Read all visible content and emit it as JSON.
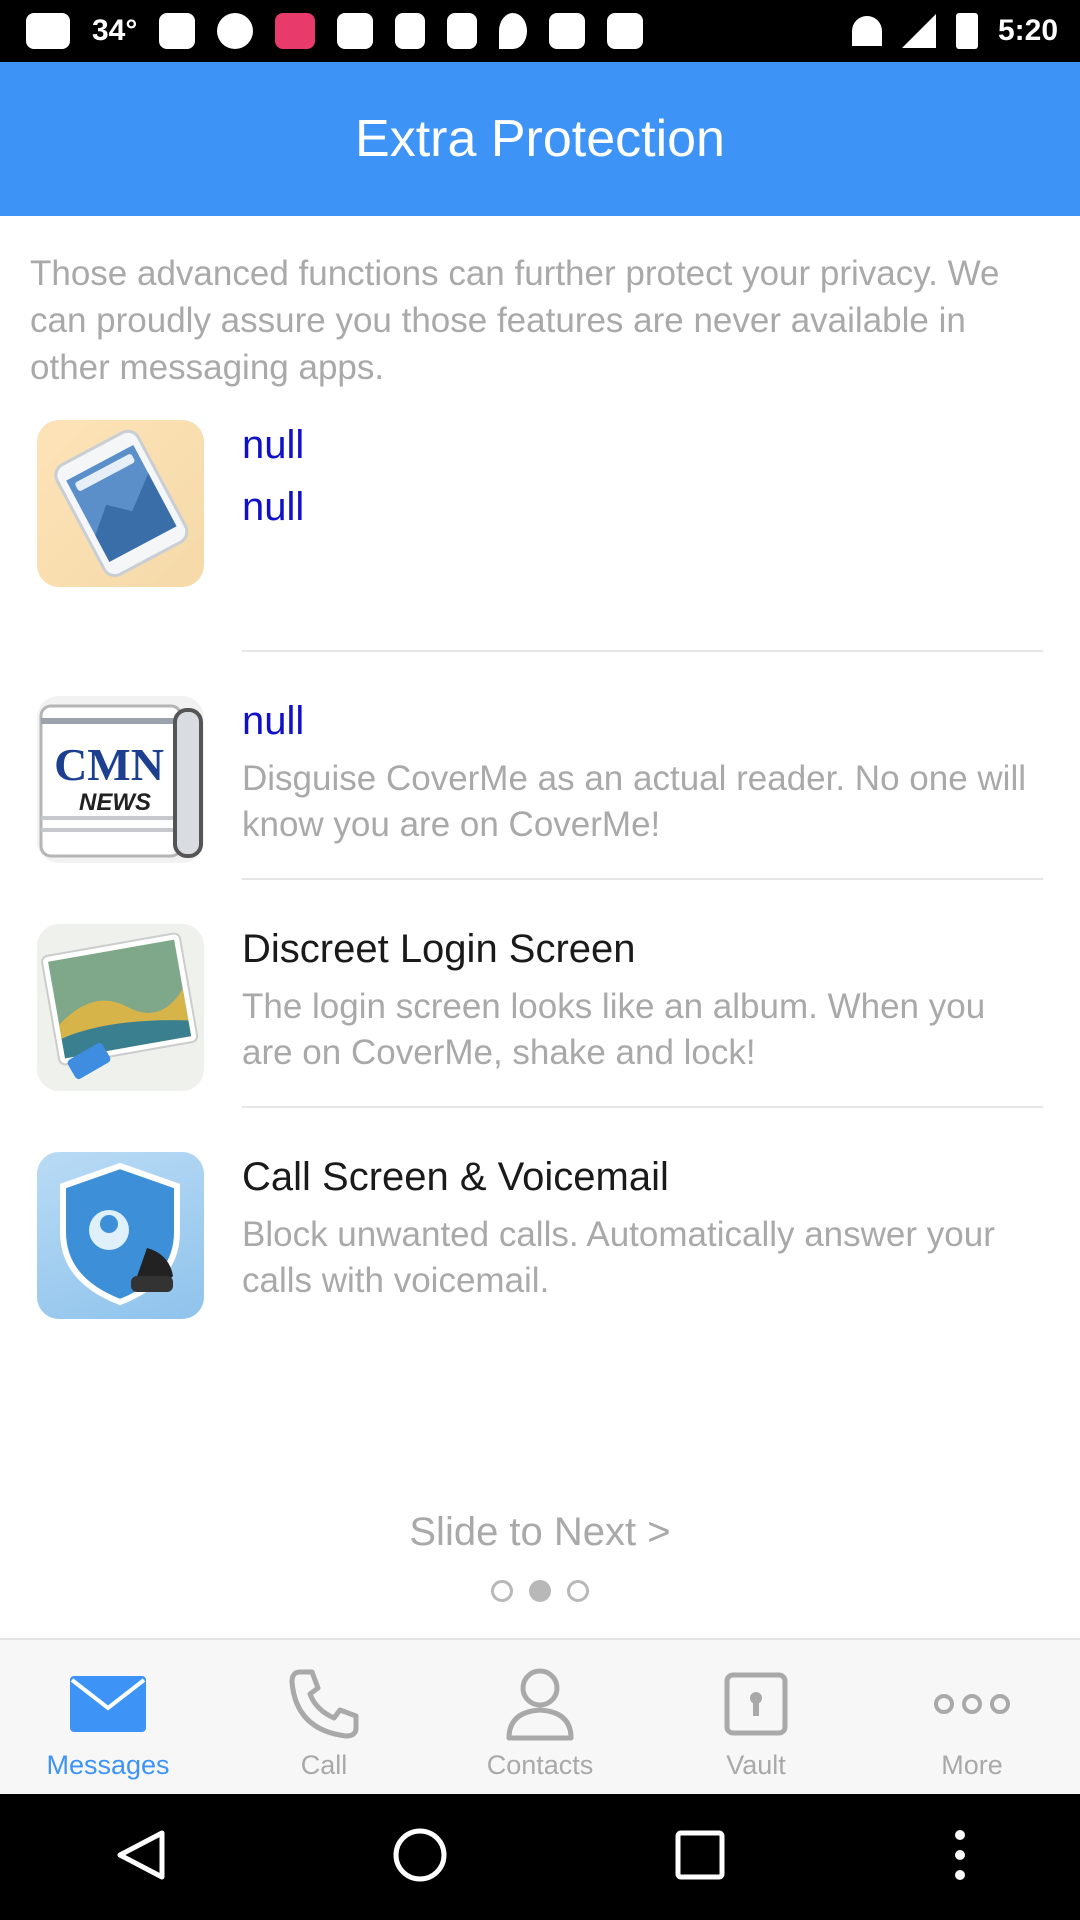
{
  "status_bar": {
    "temperature": "34°",
    "time": "5:20"
  },
  "header": {
    "title": "Extra Protection"
  },
  "intro": "Those advanced functions can further protect your privacy. We can proudly assure you those features are never available in other messaging apps.",
  "features": [
    {
      "title": "null",
      "description": "null",
      "icon": "phone-screen-icon"
    },
    {
      "title": "null",
      "description": "Disguise CoverMe as an actual reader. No one will know you are on CoverMe!",
      "icon": "cmn-news-icon",
      "icon_text_top": "CMN",
      "icon_text_bottom": "NEWS"
    },
    {
      "title": "Discreet Login Screen",
      "description": "The login screen looks like an album. When you are on CoverMe, shake and lock!",
      "icon": "photo-album-icon"
    },
    {
      "title": "Call Screen & Voicemail",
      "description": "Block unwanted calls. Automatically answer your calls with voicemail.",
      "icon": "shield-phone-icon"
    }
  ],
  "pager": {
    "label": "Slide to Next >",
    "pages": 3,
    "current": 2
  },
  "tabs": [
    {
      "label": "Messages",
      "icon": "envelope-icon",
      "active": true
    },
    {
      "label": "Call",
      "icon": "phone-icon",
      "active": false
    },
    {
      "label": "Contacts",
      "icon": "person-icon",
      "active": false
    },
    {
      "label": "Vault",
      "icon": "vault-icon",
      "active": false
    },
    {
      "label": "More",
      "icon": "more-icon",
      "active": false
    }
  ],
  "colors": {
    "accent": "#3d94f6",
    "null_text": "#1010c8",
    "muted_text": "#a9a9a9"
  }
}
